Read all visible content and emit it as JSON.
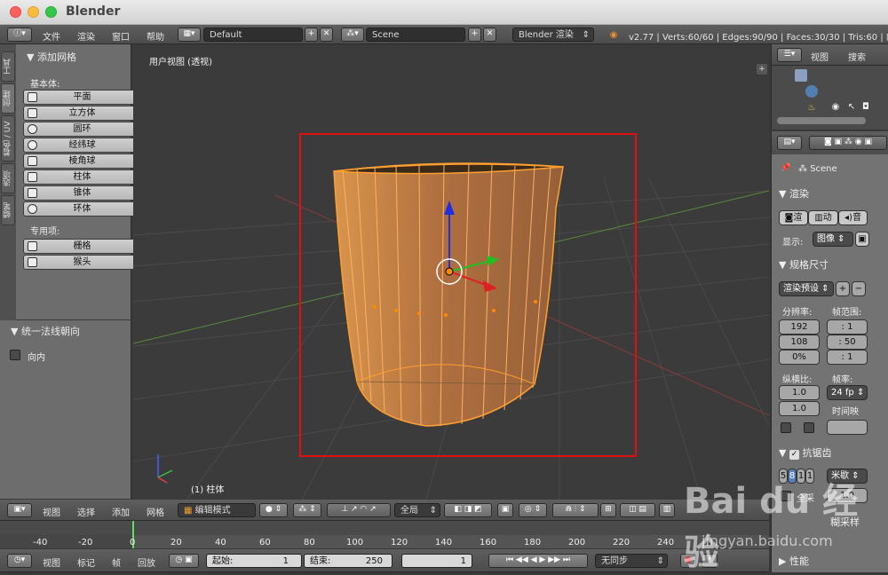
{
  "window": {
    "title": "Blender"
  },
  "info_header": {
    "menus": [
      "文件",
      "渲染",
      "窗口",
      "帮助"
    ],
    "layout": "Default",
    "scene": "Scene",
    "engine": "Blender 渲染",
    "stats": "v2.77 | Verts:60/60 | Edges:90/90 | Faces:30/30 | Tris:60 | 内"
  },
  "left_tabs": [
    "工具",
    "创建",
    "着色 / UV",
    "选项",
    "蜡笔"
  ],
  "toolshelf": {
    "panel_title": "添加网格",
    "basic_label": "基本体:",
    "basic": [
      "平面",
      "立方体",
      "圆环",
      "经纬球",
      "棱角球",
      "柱体",
      "锥体",
      "环体"
    ],
    "special_label": "专用项:",
    "special": [
      "栅格",
      "猴头"
    ]
  },
  "operator_panel": {
    "title": "统一法线朝向",
    "checkbox_label": "向内"
  },
  "viewport": {
    "view_label": "用户视图 (透视)",
    "object_label": "(1) 柱体"
  },
  "view3d_header": {
    "menus": [
      "视图",
      "选择",
      "添加",
      "网格"
    ],
    "mode": "编辑模式",
    "orientation": "全局"
  },
  "timeline": {
    "ticks": [
      "-40",
      "-20",
      "0",
      "20",
      "40",
      "60",
      "80",
      "100",
      "120",
      "140",
      "160",
      "180",
      "200",
      "220",
      "240"
    ],
    "menus": [
      "视图",
      "标记",
      "帧",
      "回放"
    ],
    "start_label": "起始:",
    "start_value": "1",
    "end_label": "结束:",
    "end_value": "250",
    "current_frame": "1",
    "sync": "无同步"
  },
  "outliner": {
    "menus": [
      "视图",
      "搜索"
    ]
  },
  "properties": {
    "scene_name": "Scene",
    "render_title": "渲染",
    "render_buttons": [
      "渲",
      "动",
      "音"
    ],
    "display_label": "显示:",
    "display_value": "图像",
    "dimensions_title": "规格尺寸",
    "preset": "渲染预设",
    "resolution_label": "分辨率:",
    "frame_range_label": "帧范围:",
    "res_x": "192",
    "res_y": "108",
    "res_pct": "0%",
    "frame_start": ": 1",
    "frame_end": ": 50",
    "frame_step": ": 1",
    "aspect_label": "纵横比:",
    "framerate_label": "帧率:",
    "aspect_x": "1.0",
    "aspect_y": "1.0",
    "fps": "24 fp",
    "time_remap_label": "时间映",
    "antialias_title": "抗锯齿",
    "aa_samples": [
      "5",
      "8",
      "1",
      "1"
    ],
    "filter": "米歇",
    "full_sample_label": "全采",
    "filter_size": "1.0",
    "motion_blur_partial": "糊采样",
    "performance_title": "性能"
  },
  "watermark": {
    "brand": "Bai du 经验",
    "url": "jingyan.baidu.com"
  },
  "colors": {
    "accent_selection": "#ff9f30",
    "frame_highlight": "#e01010"
  }
}
